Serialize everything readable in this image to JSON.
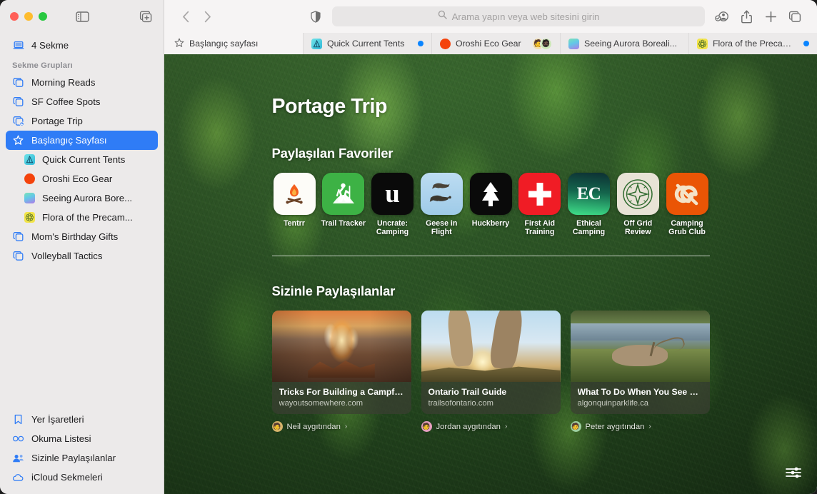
{
  "window": {
    "traffic": [
      "close",
      "minimize",
      "zoom"
    ],
    "sidebar_toggle_icon": "sidebar-toggle-icon",
    "new_tab_group_icon": "new-tab-group-icon"
  },
  "toolbar": {
    "back_icon": "back-chevron-icon",
    "forward_icon": "forward-chevron-icon",
    "shield_icon": "privacy-shield-icon",
    "search_placeholder": "Arama yapın veya web sitesini girin",
    "search_icon": "search-icon",
    "profile_icon": "shared-profile-icon",
    "share_icon": "share-icon",
    "new_tab_icon": "plus-icon",
    "tab_overview_icon": "tab-overview-icon"
  },
  "sidebar": {
    "devices": {
      "label": "4 Sekme",
      "icon": "laptop-icon"
    },
    "group_header": "Sekme Grupları",
    "groups": [
      {
        "label": "Morning Reads",
        "icon": "tab-group-icon"
      },
      {
        "label": "SF Coffee Spots",
        "icon": "tab-group-icon"
      },
      {
        "label": "Portage Trip",
        "icon": "shared-tab-group-icon"
      }
    ],
    "tabs": [
      {
        "label": "Başlangıç Sayfası",
        "icon": "star-icon",
        "selected": true
      },
      {
        "label": "Quick Current Tents",
        "favicon": "tent-favicon"
      },
      {
        "label": "Oroshi Eco Gear",
        "favicon": "orange-circle-favicon"
      },
      {
        "label": "Seeing Aurora Bore...",
        "favicon": "aurora-gradient-favicon"
      },
      {
        "label": "Flora of the Precam...",
        "favicon": "yellow-flower-favicon"
      }
    ],
    "groups_after": [
      {
        "label": "Mom's Birthday Gifts",
        "icon": "tab-group-icon"
      },
      {
        "label": "Volleyball Tactics",
        "icon": "tab-group-icon"
      }
    ],
    "bottom": [
      {
        "label": "Yer İşaretleri",
        "icon": "bookmark-icon"
      },
      {
        "label": "Okuma Listesi",
        "icon": "glasses-icon"
      },
      {
        "label": "Sizinle Paylaşılanlar",
        "icon": "shared-with-you-icon"
      },
      {
        "label": "iCloud Sekmeleri",
        "icon": "cloud-icon"
      }
    ]
  },
  "tabbar": {
    "start_tab": {
      "label": "Başlangıç sayfası",
      "icon": "star-icon"
    },
    "tabs": [
      {
        "label": "Quick Current Tents",
        "favicon": "tent-favicon",
        "badge": "blue-dot"
      },
      {
        "label": "Oroshi Eco Gear",
        "favicon": "orange-circle-favicon",
        "badge": "avatar-group"
      },
      {
        "label": "Seeing Aurora Boreali...",
        "favicon": "aurora-gradient-favicon",
        "badge": ""
      },
      {
        "label": "Flora of the Precambi...",
        "favicon": "yellow-flower-favicon",
        "badge": "blue-dot"
      }
    ]
  },
  "startpage": {
    "title": "Portage Trip",
    "favorites_heading": "Paylaşılan Favoriler",
    "favorites": [
      {
        "name": "Tentrr",
        "icon": "campfire-icon"
      },
      {
        "name": "Trail Tracker",
        "icon": "hiker-icon"
      },
      {
        "name": "Uncrate: Camping",
        "icon": "letter-u-icon"
      },
      {
        "name": "Geese in Flight",
        "icon": "geese-icon"
      },
      {
        "name": "Huckberry",
        "icon": "pine-tree-icon"
      },
      {
        "name": "First Aid Training",
        "icon": "first-aid-cross-icon"
      },
      {
        "name": "Ethical Camping",
        "icon": "ec-monogram-icon"
      },
      {
        "name": "Off Grid Review",
        "icon": "compass-icon"
      },
      {
        "name": "Camping Grub Club",
        "icon": "cg-monogram-icon"
      }
    ],
    "shared_heading": "Sizinle Paylaşılanlar",
    "shared_cards": [
      {
        "title": "Tricks For Building a Campfire—F...",
        "site": "wayoutsomewhere.com",
        "from": "Neil aygıtından",
        "image": "campfire-photo",
        "chevron": "›"
      },
      {
        "title": "Ontario Trail Guide",
        "site": "trailsofontario.com",
        "from": "Jordan aygıtından",
        "image": "hikers-sunset-photo",
        "chevron": "›"
      },
      {
        "title": "What To Do When You See a Moo...",
        "site": "algonquinparklife.ca",
        "from": "Peter aygıtından",
        "image": "elk-lake-photo",
        "chevron": "›"
      }
    ],
    "customize_icon": "sliders-icon"
  },
  "colors": {
    "accent": "#2f7cf6",
    "blue_dot": "#0a84ff",
    "sidebar_bg": "#eceaea",
    "toolbar_bg": "#f6f4f4"
  }
}
